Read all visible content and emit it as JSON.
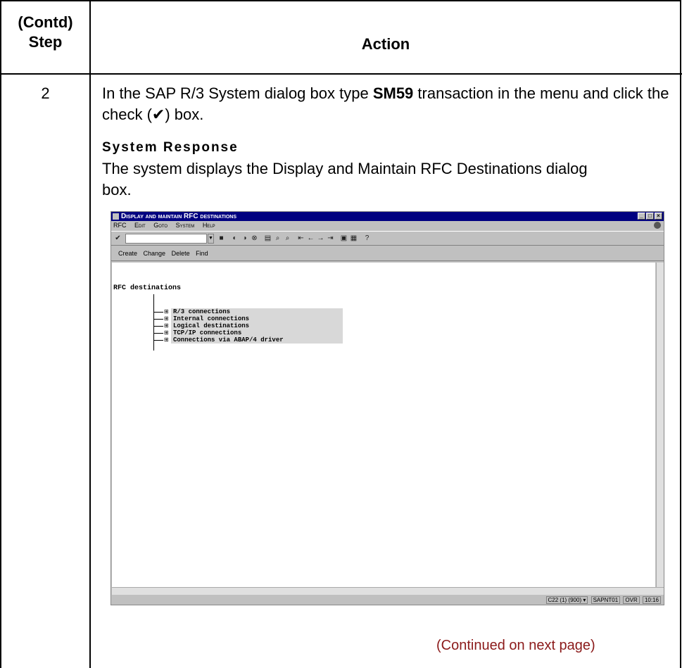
{
  "table": {
    "header_step": [
      "(Contd)",
      "Step"
    ],
    "header_action": "Action",
    "step_number": "2",
    "instruction_pre": "In the SAP R/3 System dialog box type ",
    "instruction_bold": "SM59",
    "instruction_post": " transaction in the menu and click the check (✔) box.",
    "response_title": "System Response",
    "response_text": "The system displays the Display and Maintain RFC Destinations dialog box.",
    "continued": "(Continued on next page)"
  },
  "sap_window": {
    "title": "Display and maintain RFC destinations",
    "menu": [
      "RFC",
      "Edit",
      "Goto",
      "System",
      "Help"
    ],
    "app_toolbar": [
      "Create",
      "Change",
      "Delete",
      "Find"
    ],
    "tree_root": "RFC destinations",
    "tree_items": [
      "R/3 connections",
      "Internal connections",
      "Logical destinations",
      "TCP/IP connections",
      "Connections via ABAP/4 driver"
    ],
    "status": [
      "C22 (1) (900) ▾",
      "SAPNT01",
      "OVR",
      "10:16"
    ]
  }
}
